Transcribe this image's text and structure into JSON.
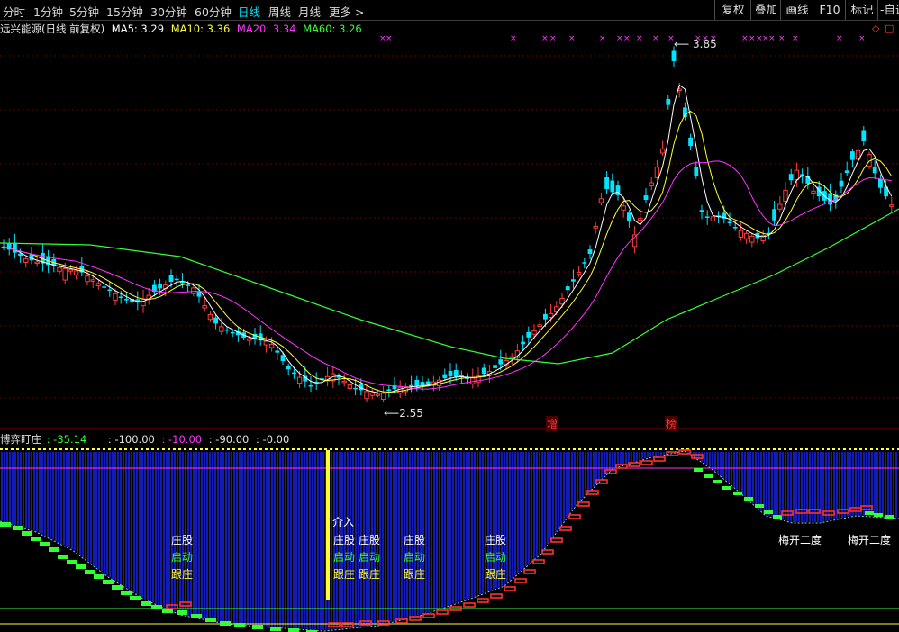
{
  "toolbar": {
    "periods": [
      "分时",
      "1分钟",
      "5分钟",
      "15分钟",
      "30分钟",
      "60分钟",
      "日线",
      "周线",
      "月线",
      "更多 >"
    ],
    "active_period": "日线",
    "right_buttons": [
      "复权",
      "叠加",
      "画线",
      "F10",
      "标记",
      "-自选"
    ]
  },
  "stock_info": {
    "name": "远兴能源(日线 前复权)",
    "ma5": "MA5: 3.29",
    "ma10": "MA10: 3.36",
    "ma20": "MA20: 3.34",
    "ma60": "MA60: 3.26"
  },
  "price_labels": {
    "high": "3.85",
    "low": "2.55"
  },
  "event_markers": [
    "增",
    "榜"
  ],
  "indicator": {
    "name": "博弈盯庄",
    "v1": ": -35.14",
    "v2": ": -100.00",
    "v3": ": -10.00",
    "v4": ": -90.00",
    "v5": ": -0.00"
  },
  "signals": {
    "jieru": "介入",
    "zhuanggu": "庄股",
    "qidong": "启动",
    "genzhuang": "跟庄",
    "meikai": "梅开二度"
  },
  "colors": {
    "up": "#ff3b3b",
    "down": "#00e5ff",
    "ma5": "#ffffff",
    "ma10": "#ffff33",
    "ma20": "#ff33ff",
    "ma60": "#33ff33",
    "bars": "#1a22e0"
  }
}
